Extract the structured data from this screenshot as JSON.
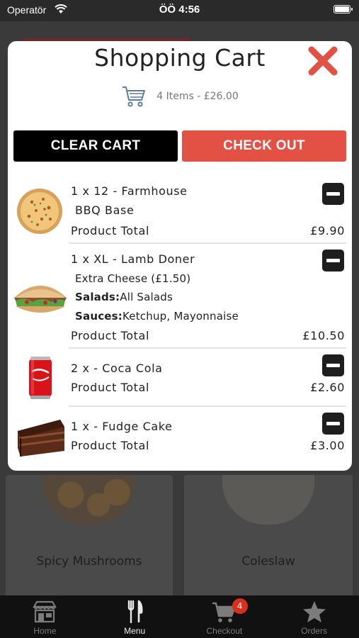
{
  "status_bar": {
    "carrier": "Operatör",
    "time": "ÖÖ 4:56"
  },
  "background": {
    "cards": [
      {
        "label": "Spicy Mushrooms"
      },
      {
        "label": "Coleslaw"
      }
    ]
  },
  "cart": {
    "title": "Shopping Cart",
    "summary": "4 Items - £26.00",
    "clear_label": "CLEAR CART",
    "checkout_label": "CHECK OUT",
    "items": [
      {
        "name": "1 x 12 - Farmhouse",
        "option": "BBQ Base",
        "total_label": "Product Total",
        "price": "£9.90"
      },
      {
        "name": "1 x XL - Lamb Doner",
        "extra": "Extra Cheese (£1.50)",
        "salads_label": "Salads:",
        "salads_value": "All Salads",
        "sauces_label": "Sauces:",
        "sauces_value": "Ketchup, Mayonnaise",
        "total_label": "Product Total",
        "price": "£10.50"
      },
      {
        "name": "2 x - Coca Cola",
        "total_label": "Product Total",
        "price": "£2.60"
      },
      {
        "name": "1 x - Fudge Cake",
        "total_label": "Product Total",
        "price": "£3.00"
      }
    ]
  },
  "tabs": [
    {
      "label": "Home",
      "icon": "store-icon",
      "active": false
    },
    {
      "label": "Menu",
      "icon": "cutlery-icon",
      "active": true
    },
    {
      "label": "Checkout",
      "icon": "cart-icon",
      "badge": "4",
      "active": false
    },
    {
      "label": "Orders",
      "icon": "star-icon",
      "active": false
    }
  ],
  "colors": {
    "accent": "#e25144",
    "clear_button": "#000000",
    "close_icon": "#e25144",
    "badge": "#d9301e"
  }
}
